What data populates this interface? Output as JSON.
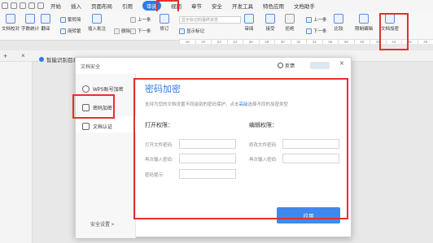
{
  "menu": {
    "tabs": [
      "开始",
      "插入",
      "页面布局",
      "引用",
      "审阅",
      "视图",
      "章节",
      "安全",
      "开发工具",
      "特色应用",
      "文档助手"
    ],
    "active_tab": "审阅"
  },
  "ribbon": {
    "items": [
      {
        "label": "文档校对"
      },
      {
        "label": "字数统计"
      },
      {
        "label": "翻译"
      },
      {
        "label": "插入批注"
      },
      {
        "label": "修订"
      },
      {
        "label": "审阅"
      },
      {
        "label": "接受"
      },
      {
        "label": "拒绝"
      },
      {
        "label": "比较"
      },
      {
        "label": "限制编辑"
      },
      {
        "label": "文档加密"
      }
    ],
    "small": {
      "fanjian": "繁转简",
      "jianfan": "简转繁",
      "delete": "删除",
      "prev": "上一条",
      "next": "下一条",
      "show_marks": "显示标记",
      "prev2": "上一条",
      "next2": "下一条"
    },
    "combo_placeholder": "显示标记的最终状态",
    "ruler": [
      "18",
      "20",
      "22",
      "24",
      "26",
      "28",
      "30",
      "32",
      "34",
      "36",
      "38",
      "40",
      "42",
      "44",
      "46",
      "48"
    ]
  },
  "doc": {
    "tab_label": "智能识别目录"
  },
  "dialog": {
    "title": "文档安全",
    "feedback": "反馈",
    "close": "×",
    "sidebar": [
      {
        "label": "WPS账号加密"
      },
      {
        "label": "密码加密"
      },
      {
        "label": "文档认证"
      }
    ],
    "sidebar_footer": "安全设置 >",
    "content": {
      "title": "密码加密",
      "desc_prefix": "支持为您的文档设置不同级别的密码保护，点击",
      "desc_link": "高级",
      "desc_suffix": "选择不同的加密类型",
      "open_title": "打开权限：",
      "edit_title": "编辑权限：",
      "open_fields": [
        "打开文件密码:",
        "再次输入密码:",
        "密码提示:"
      ],
      "edit_fields": [
        "修改文件密码:",
        "再次输入密码:"
      ],
      "apply": "应用"
    }
  },
  "colors": {
    "accent": "#2f7be5",
    "highlight": "#e5302b",
    "apply_button": "#3f88f0"
  }
}
